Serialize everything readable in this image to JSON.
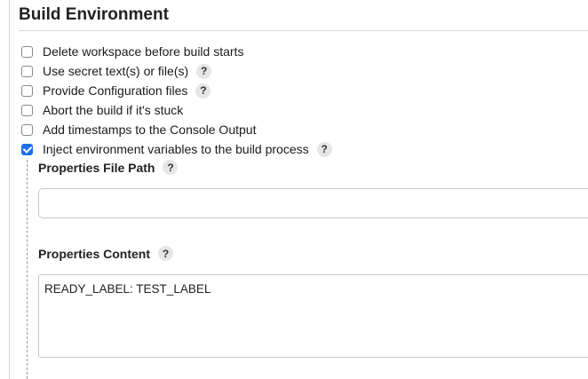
{
  "section": {
    "title": "Build Environment"
  },
  "options": [
    {
      "label": "Delete workspace before build starts",
      "checked": false,
      "help": false
    },
    {
      "label": "Use secret text(s) or file(s)",
      "checked": false,
      "help": true
    },
    {
      "label": "Provide Configuration files",
      "checked": false,
      "help": true
    },
    {
      "label": "Abort the build if it's stuck",
      "checked": false,
      "help": false
    },
    {
      "label": "Add timestamps to the Console Output",
      "checked": false,
      "help": false
    },
    {
      "label": "Inject environment variables to the build process",
      "checked": true,
      "help": true
    }
  ],
  "help_glyph": "?",
  "inject": {
    "properties_file_path": {
      "label": "Properties File Path",
      "value": ""
    },
    "properties_content": {
      "label": "Properties Content",
      "value": "READY_LABEL: TEST_LABEL"
    }
  },
  "colors": {
    "checkbox_accent": "#1773e8",
    "help_badge_bg": "#e6e6e6"
  },
  "icons": {
    "help": "question-mark-help-icon",
    "check": "checkmark-icon"
  }
}
